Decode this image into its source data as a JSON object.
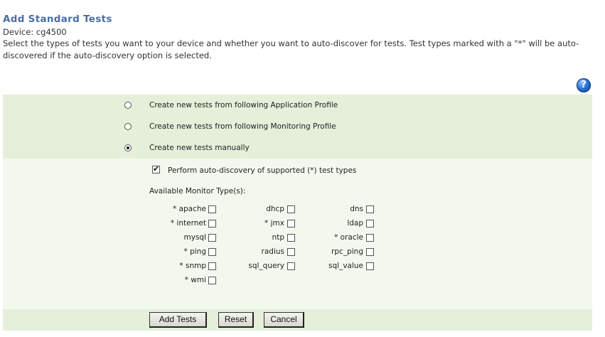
{
  "header": {
    "title": "Add Standard Tests",
    "device_line": "Device: cg4500",
    "description": "Select the types of tests you want to your device and whether you want to auto-discover for tests. Test types marked with a \"*\" will be auto-discovered if the auto-discovery option is selected."
  },
  "help": {
    "icon": "help-icon",
    "glyph": "?"
  },
  "options": [
    {
      "label": "Create new tests from following Application Profile",
      "selected": false
    },
    {
      "label": "Create new tests from following Monitoring Profile",
      "selected": false
    },
    {
      "label": "Create new tests manually",
      "selected": true
    }
  ],
  "autodiscovery": {
    "label": "Perform auto-discovery of supported (*) test types",
    "checked": true
  },
  "monitor_types": {
    "heading": "Available Monitor Type(s):",
    "items": [
      {
        "label": "* apache",
        "checked": false
      },
      {
        "label": "dhcp",
        "checked": false
      },
      {
        "label": "dns",
        "checked": false
      },
      {
        "label": "* internet",
        "checked": false
      },
      {
        "label": "* jmx",
        "checked": false
      },
      {
        "label": "ldap",
        "checked": false
      },
      {
        "label": "mysql",
        "checked": false
      },
      {
        "label": "ntp",
        "checked": false
      },
      {
        "label": "* oracle",
        "checked": false
      },
      {
        "label": "* ping",
        "checked": false
      },
      {
        "label": "radius",
        "checked": false
      },
      {
        "label": "rpc_ping",
        "checked": false
      },
      {
        "label": "* snmp",
        "checked": false
      },
      {
        "label": "sql_query",
        "checked": false
      },
      {
        "label": "sql_value",
        "checked": false
      },
      {
        "label": "* wmi",
        "checked": false
      }
    ]
  },
  "buttons": {
    "add_tests": "Add Tests",
    "reset": "Reset",
    "cancel": "Cancel"
  }
}
